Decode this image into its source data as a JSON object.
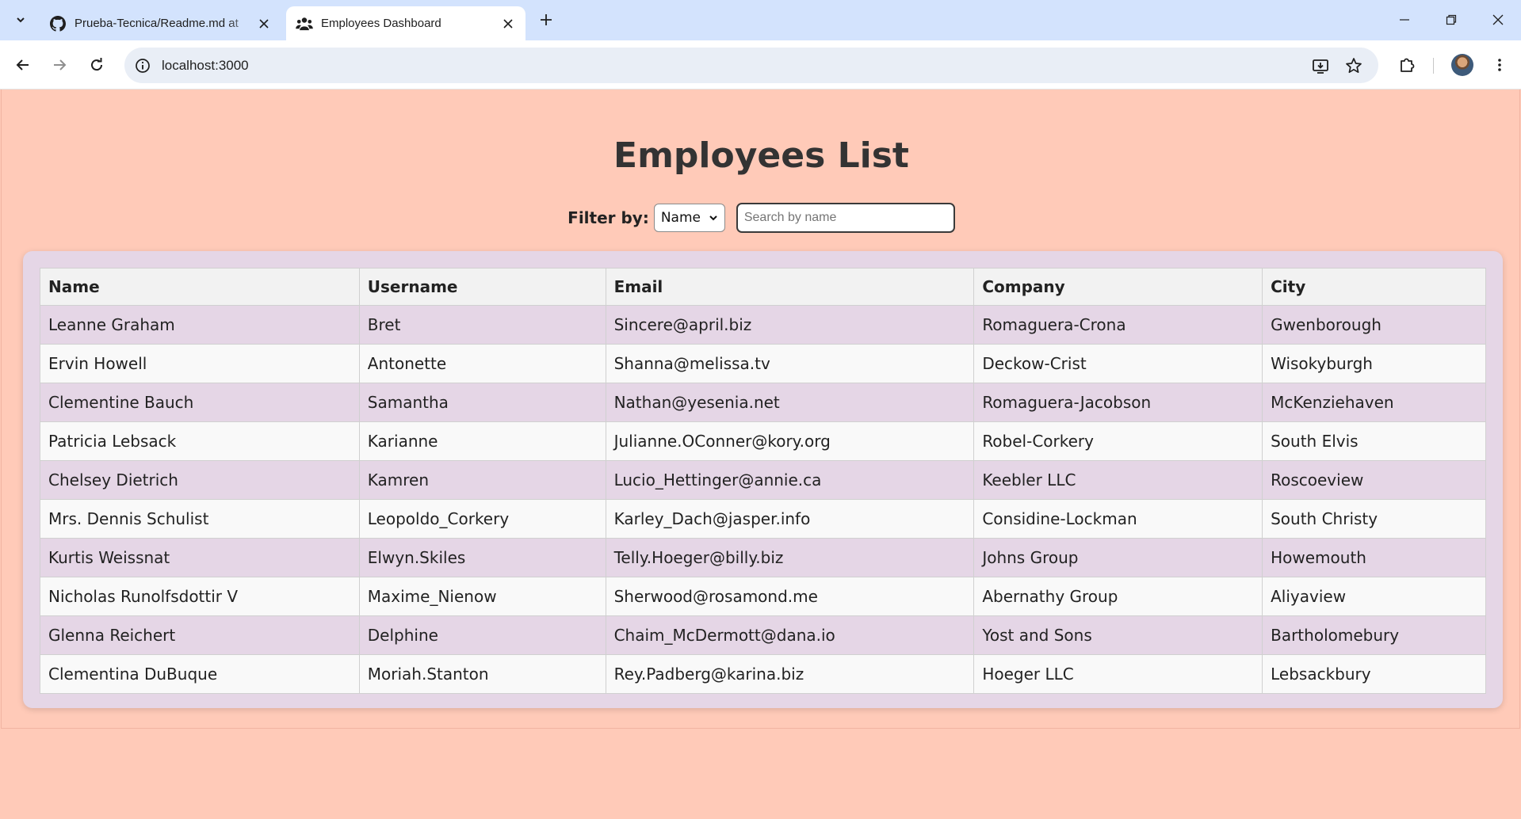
{
  "browser": {
    "tabs": [
      {
        "title": "Prueba-Tecnica/Readme.md at",
        "icon": "github-icon",
        "active": false
      },
      {
        "title": "Employees Dashboard",
        "icon": "users-icon",
        "active": true
      }
    ],
    "url": "localhost:3000"
  },
  "page": {
    "title": "Employees List",
    "filter": {
      "label": "Filter by:",
      "selected_option": "Name",
      "search_placeholder": "Search by name",
      "search_value": ""
    }
  },
  "table": {
    "headers": [
      "Name",
      "Username",
      "Email",
      "Company",
      "City"
    ],
    "rows": [
      [
        "Leanne Graham",
        "Bret",
        "Sincere@april.biz",
        "Romaguera-Crona",
        "Gwenborough"
      ],
      [
        "Ervin Howell",
        "Antonette",
        "Shanna@melissa.tv",
        "Deckow-Crist",
        "Wisokyburgh"
      ],
      [
        "Clementine Bauch",
        "Samantha",
        "Nathan@yesenia.net",
        "Romaguera-Jacobson",
        "McKenziehaven"
      ],
      [
        "Patricia Lebsack",
        "Karianne",
        "Julianne.OConner@kory.org",
        "Robel-Corkery",
        "South Elvis"
      ],
      [
        "Chelsey Dietrich",
        "Kamren",
        "Lucio_Hettinger@annie.ca",
        "Keebler LLC",
        "Roscoeview"
      ],
      [
        "Mrs. Dennis Schulist",
        "Leopoldo_Corkery",
        "Karley_Dach@jasper.info",
        "Considine-Lockman",
        "South Christy"
      ],
      [
        "Kurtis Weissnat",
        "Elwyn.Skiles",
        "Telly.Hoeger@billy.biz",
        "Johns Group",
        "Howemouth"
      ],
      [
        "Nicholas Runolfsdottir V",
        "Maxime_Nienow",
        "Sherwood@rosamond.me",
        "Abernathy Group",
        "Aliyaview"
      ],
      [
        "Glenna Reichert",
        "Delphine",
        "Chaim_McDermott@dana.io",
        "Yost and Sons",
        "Bartholomebury"
      ],
      [
        "Clementina DuBuque",
        "Moriah.Stanton",
        "Rey.Padberg@karina.biz",
        "Hoeger LLC",
        "Lebsackbury"
      ]
    ]
  },
  "colors": {
    "page_background": "#ffcab8",
    "table_card": "#e5d6e6",
    "row_even": "#f9f9f9",
    "header_background": "#f2f2f2",
    "tabbar": "#d3e3fd"
  }
}
